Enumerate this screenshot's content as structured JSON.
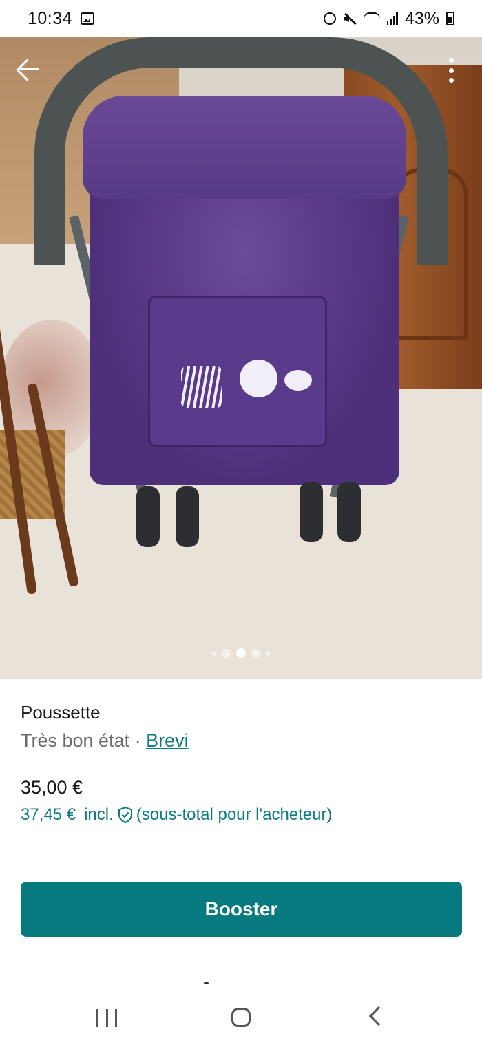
{
  "status_bar": {
    "time": "10:34",
    "battery": "43%",
    "icons": [
      "image-icon",
      "alarm-icon",
      "mute-icon",
      "wifi-icon",
      "signal-icon",
      "battery-icon"
    ]
  },
  "photo": {
    "carousel_count": 5,
    "carousel_active_index": 2
  },
  "item": {
    "title": "Poussette",
    "condition": "Très bon état",
    "separator": " · ",
    "brand": "Brevi",
    "price": "35,00 €",
    "price_incl_amount": "37,45 €",
    "price_incl_word": "incl.",
    "price_incl_note": "(sous-total pour l'acheteur)"
  },
  "actions": {
    "booster_label": "Booster"
  },
  "colors": {
    "accent": "#077a80",
    "link": "#0e7b80",
    "muted_text": "#6b6b6b"
  }
}
